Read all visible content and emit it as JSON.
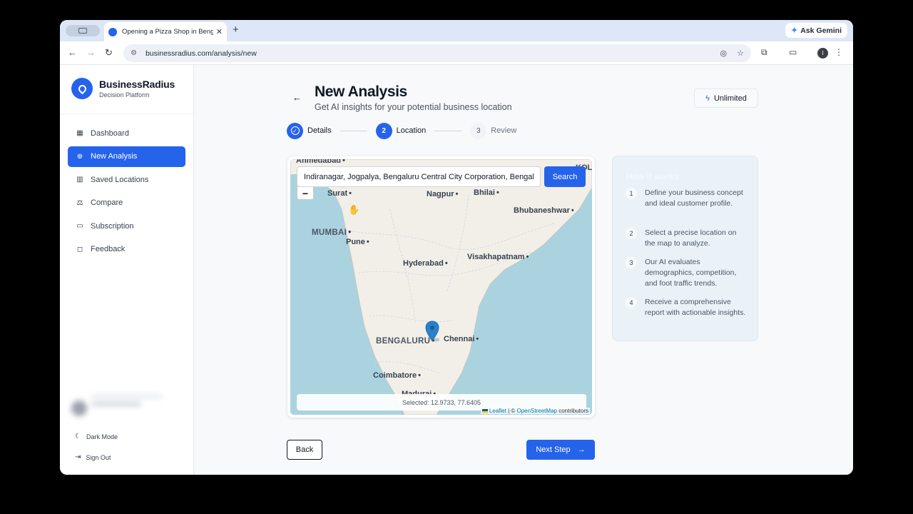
{
  "browser": {
    "tab_title": "Opening a Pizza Shop in Benga",
    "tab_close": "✕",
    "new_tab": "+",
    "gemini_label": "Ask Gemini",
    "url": "businessradius.com/analysis/new",
    "profile_initial": "I"
  },
  "brand": {
    "name": "BusinessRadius",
    "subtitle": "Decision Platform",
    "accent": "#2563eb"
  },
  "sidebar": {
    "items": [
      {
        "label": "Dashboard",
        "icon": "grid-icon",
        "active": false
      },
      {
        "label": "New Analysis",
        "icon": "plus-circle-icon",
        "active": true
      },
      {
        "label": "Saved Locations",
        "icon": "map-icon",
        "active": false
      },
      {
        "label": "Compare",
        "icon": "scale-icon",
        "active": false
      },
      {
        "label": "Subscription",
        "icon": "credit-card-icon",
        "active": false
      },
      {
        "label": "Feedback",
        "icon": "message-icon",
        "active": false
      }
    ],
    "dark_mode": "Dark Mode",
    "sign_out": "Sign Out"
  },
  "header": {
    "title": "New Analysis",
    "subtitle": "Get AI insights for your potential business location",
    "plan_badge": "Unlimited"
  },
  "stepper": {
    "steps": [
      {
        "number": "1",
        "label": "Details",
        "state": "done"
      },
      {
        "number": "2",
        "label": "Location",
        "state": "current"
      },
      {
        "number": "3",
        "label": "Review",
        "state": "todo"
      }
    ]
  },
  "map": {
    "search_value": "Indiranagar, Jogpalya, Bengaluru Central City Corporation, Bengaluru",
    "search_button": "Search",
    "zoom_out": "−",
    "selected_text": "Selected: 12.9733, 77.6405",
    "attribution_leaflet": "Leaflet",
    "attribution_sep": " | © ",
    "attribution_osm": "OpenStreetMap",
    "attribution_tail": " contributors",
    "cities": [
      {
        "name": "Ahmedabad"
      },
      {
        "name": "KOL"
      },
      {
        "name": "Surat"
      },
      {
        "name": "Nagpur"
      },
      {
        "name": "Bhilai"
      },
      {
        "name": "Bhubaneshwar"
      },
      {
        "name": "MUMBAI"
      },
      {
        "name": "Pune"
      },
      {
        "name": "Hyderabad"
      },
      {
        "name": "Visakhapatnam"
      },
      {
        "name": "BENGALURU"
      },
      {
        "name": "Chennai"
      },
      {
        "name": "Coimbatore"
      },
      {
        "name": "Madurai"
      }
    ]
  },
  "how_it_works": {
    "title": "How it works",
    "steps": [
      {
        "number": "1",
        "text": "Define your business concept and ideal customer profile."
      },
      {
        "number": "2",
        "text": "Select a precise location on the map to analyze."
      },
      {
        "number": "3",
        "text": "Our AI evaluates demographics, competition, and foot traffic trends."
      },
      {
        "number": "4",
        "text": "Receive a comprehensive report with actionable insights."
      }
    ]
  },
  "footer": {
    "back": "Back",
    "next": "Next Step"
  }
}
